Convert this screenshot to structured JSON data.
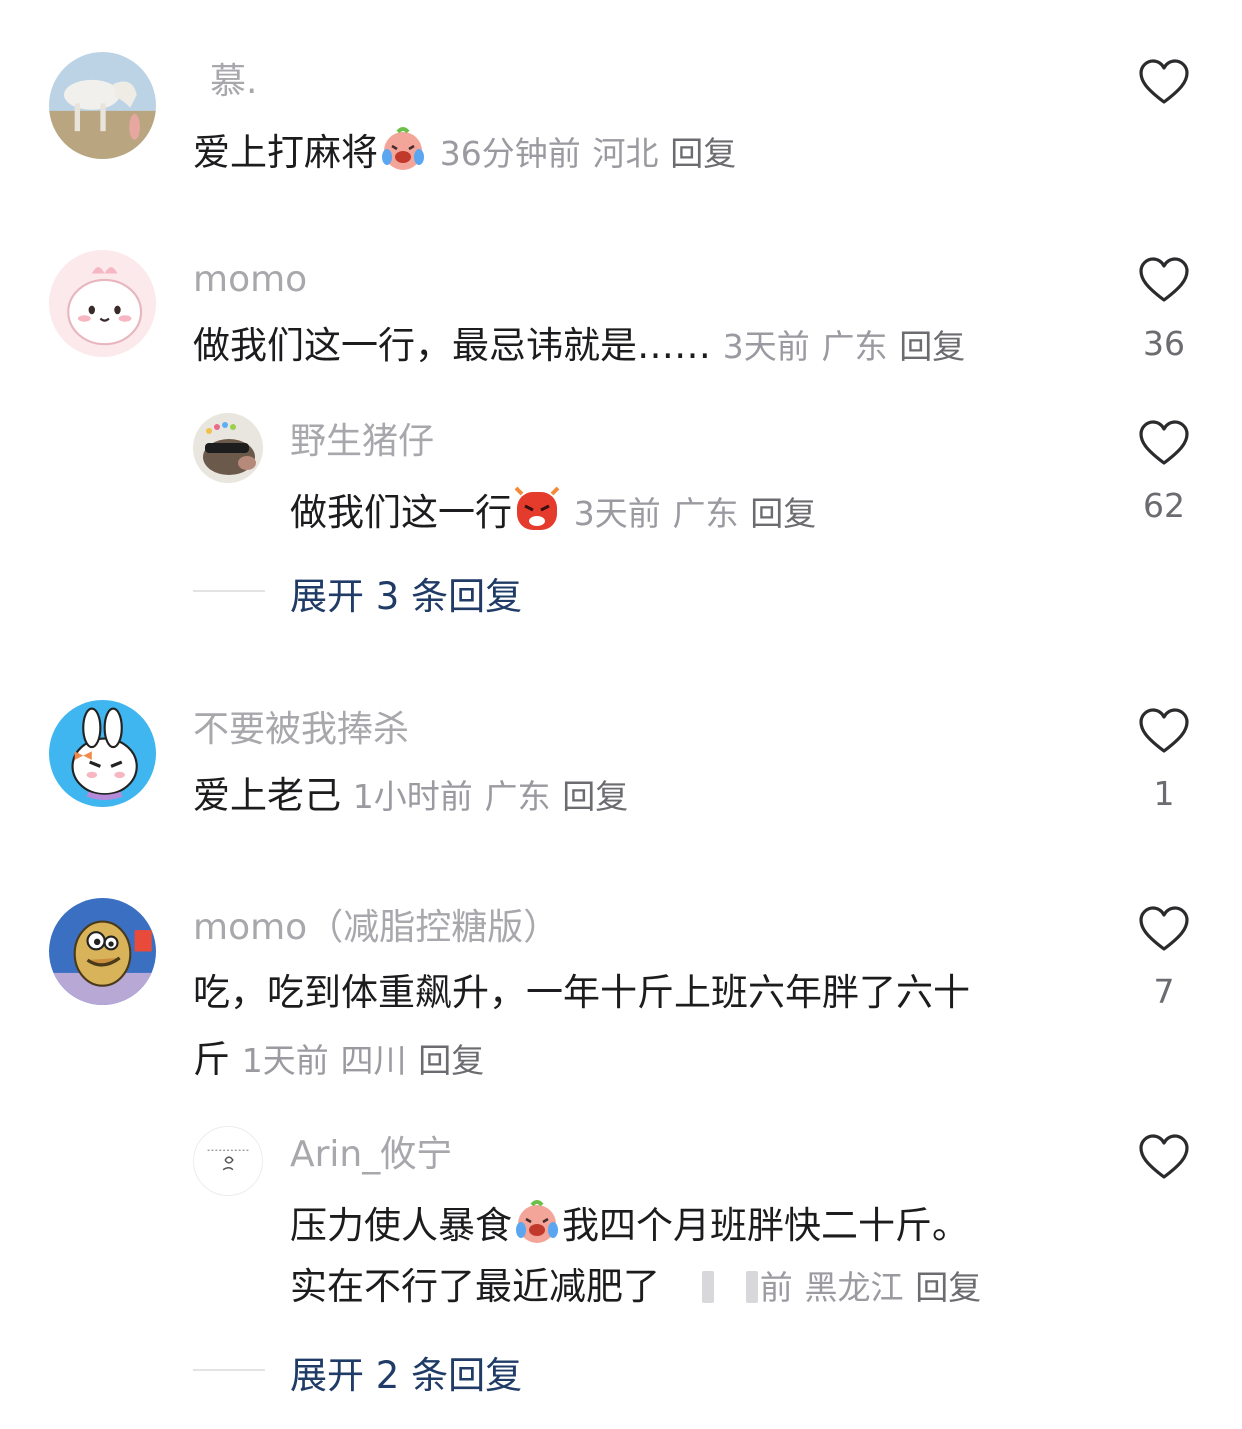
{
  "comments": [
    {
      "name": "慕.",
      "text": "爱上打麻将",
      "emoji": "laughing-tears-emoji",
      "time": "36分钟前",
      "location": "河北",
      "reply": "回复",
      "likes": ""
    },
    {
      "name": "momo",
      "text": "做我们这一行，最忌讳就是……",
      "time": "3天前",
      "location": "广东",
      "reply": "回复",
      "likes": "36",
      "replies": [
        {
          "name": "野生猪仔",
          "text": "做我们这一行",
          "emoji": "angry-face-emoji",
          "time": "3天前",
          "location": "广东",
          "reply": "回复",
          "likes": "62"
        }
      ],
      "expand": "展开 3 条回复"
    },
    {
      "name": "不要被我捧杀",
      "text": "爱上老己",
      "time": "1小时前",
      "location": "广东",
      "reply": "回复",
      "likes": "1"
    },
    {
      "name": "momo（减脂控糖版）",
      "text_line1": "吃，吃到体重飙升，一年十斤上班六年胖了六十",
      "text_line2": "斤",
      "time": "1天前",
      "location": "四川",
      "reply": "回复",
      "likes": "7",
      "replies": [
        {
          "name": "Arin_攸宁",
          "text_line1a": "压力使人暴食",
          "emoji": "laughing-tears-emoji",
          "text_line1b": "我四个月班胖快二十斤。",
          "text_line2": "实在不行了最近减肥了",
          "time": "前",
          "location": "黑龙江",
          "reply": "回复",
          "likes": ""
        }
      ],
      "expand": "展开 2 条回复"
    }
  ]
}
